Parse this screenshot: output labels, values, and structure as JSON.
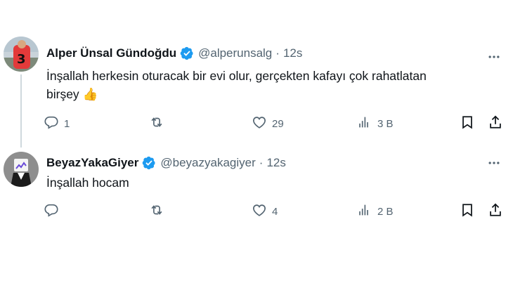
{
  "tweets": [
    {
      "author_name": "Alper Ünsal Gündoğdu",
      "handle": "@alperunsalg",
      "separator": "·",
      "time": "12s",
      "text_line1": "İnşallah herkesin oturacak bir evi olur, gerçekten kafayı çok rahatlatan",
      "text_line2": "birşey",
      "emoji": "👍",
      "replies": "1",
      "retweets": "",
      "likes": "29",
      "views": "3 B"
    },
    {
      "author_name": "BeyazYakaGiyer",
      "handle": "@beyazyakagiyer",
      "separator": "·",
      "time": "12s",
      "text_line1": "İnşallah hocam",
      "replies": "",
      "retweets": "",
      "likes": "4",
      "views": "2 B"
    }
  ],
  "colors": {
    "text": "#0f1419",
    "secondary": "#536471",
    "verified": "#1d9bf0",
    "thread_line": "#cfd9de"
  },
  "icons": [
    "verified-badge-icon",
    "more-icon",
    "reply-icon",
    "retweet-icon",
    "like-icon",
    "views-icon",
    "bookmark-icon",
    "share-icon"
  ]
}
